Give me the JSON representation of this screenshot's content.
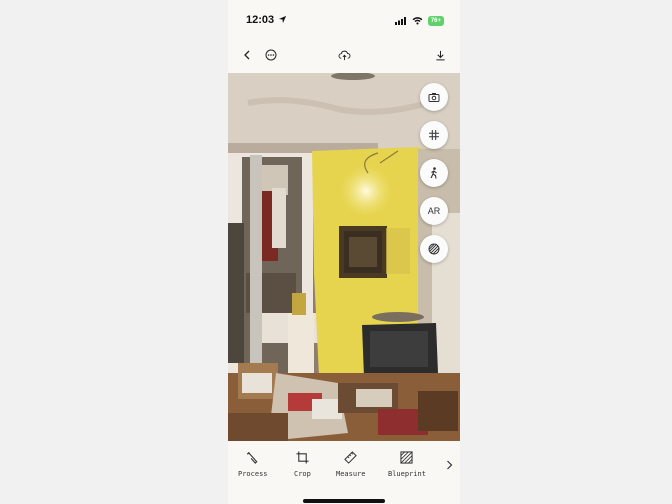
{
  "status_bar": {
    "time": "12:03",
    "battery": "76+"
  },
  "top_bar": {
    "back": "chevron-left-icon",
    "more": "ellipsis-icon",
    "upload": "cloud-upload-icon",
    "download": "download-icon"
  },
  "side_buttons": [
    {
      "name": "camera-icon"
    },
    {
      "name": "grid-icon"
    },
    {
      "name": "walk-icon"
    },
    {
      "label": "AR"
    },
    {
      "name": "texture-icon"
    }
  ],
  "tools": [
    {
      "label": "Process",
      "icon": "wrench-icon"
    },
    {
      "label": "Crop",
      "icon": "crop-icon"
    },
    {
      "label": "Measure",
      "icon": "ruler-icon"
    },
    {
      "label": "Blueprint",
      "icon": "blueprint-icon"
    }
  ],
  "colors": {
    "wall": "#e6d44e",
    "ceiling": "#d9cfc2",
    "floor": "#8b5e3a"
  }
}
